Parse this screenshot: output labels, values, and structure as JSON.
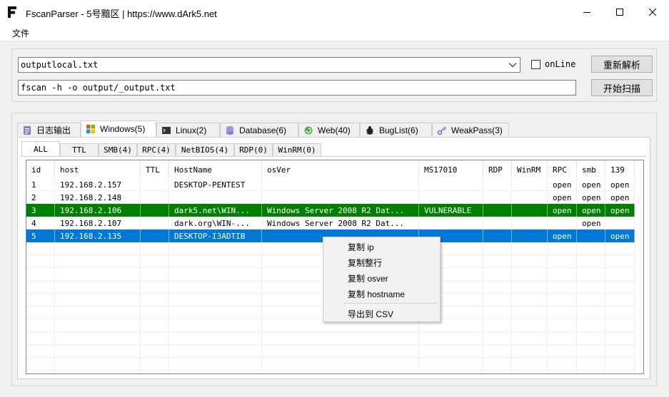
{
  "window": {
    "title": "FscanParser - 5号黯区 | https://www.dArk5.net",
    "app_icon": "letter-f-logo",
    "controls": [
      "minimize-icon",
      "maximize-icon",
      "close-icon"
    ]
  },
  "menu": {
    "file": "文件"
  },
  "top": {
    "file_combo_value": "outputlocal.txt",
    "command_value": "fscan -h -o output/_output.txt",
    "online_label": "onLine",
    "online_checked": false,
    "reparse_label": "重新解析",
    "scan_label": "开始扫描"
  },
  "outer_tabs": [
    {
      "label": "日志输出",
      "icon": "log-icon"
    },
    {
      "label": "Windows(5)",
      "icon": "windows-icon",
      "active": true
    },
    {
      "label": "Linux(2)",
      "icon": "terminal-icon"
    },
    {
      "label": "Database(6)",
      "icon": "database-icon"
    },
    {
      "label": "Web(40)",
      "icon": "web-icon"
    },
    {
      "label": "BugList(6)",
      "icon": "bug-icon"
    },
    {
      "label": "WeakPass(3)",
      "icon": "key-icon"
    }
  ],
  "inner_tabs": [
    {
      "label": "ALL",
      "active": true
    },
    {
      "label": "TTL"
    },
    {
      "label": "SMB(4)"
    },
    {
      "label": "RPC(4)"
    },
    {
      "label": "NetBIOS(4)"
    },
    {
      "label": "RDP(0)"
    },
    {
      "label": "WinRM(0)"
    }
  ],
  "table": {
    "columns": [
      "id",
      "host",
      "TTL",
      "HostName",
      "osVer",
      "MS17010",
      "RDP",
      "WinRM",
      "RPC",
      "smb",
      "139"
    ],
    "rows": [
      [
        "1",
        "192.168.2.157",
        "",
        "DESKTOP-PENTEST",
        "",
        "",
        "",
        "",
        "open",
        "open",
        "open"
      ],
      [
        "2",
        "192.168.2.148",
        "",
        "",
        "",
        "",
        "",
        "",
        "open",
        "open",
        "open"
      ],
      [
        "3",
        "192.168.2.106",
        "",
        "dark5.net\\WIN...",
        "Windows Server 2008 R2 Dat...",
        "VULNERABLE",
        "",
        "",
        "open",
        "open",
        "open"
      ],
      [
        "4",
        "192.168.2.107",
        "",
        "dark.org\\WIN-...",
        "Windows Server 2008 R2 Dat...",
        "",
        "",
        "",
        "",
        "open",
        ""
      ],
      [
        "5",
        "192.168.2.135",
        "",
        "DESKTOP-I3ADTIB",
        "",
        "",
        "",
        "",
        "open",
        "",
        "open"
      ]
    ],
    "row_states": [
      "normal",
      "normal",
      "vulnerable",
      "normal",
      "selected"
    ],
    "colors": {
      "vulnerable": "#008000",
      "selected": "#0078d7"
    }
  },
  "context_menu": {
    "items": [
      "复制 ip",
      "复制整行",
      "复制 osver",
      "复制 hostname"
    ],
    "export": "导出到 CSV"
  }
}
